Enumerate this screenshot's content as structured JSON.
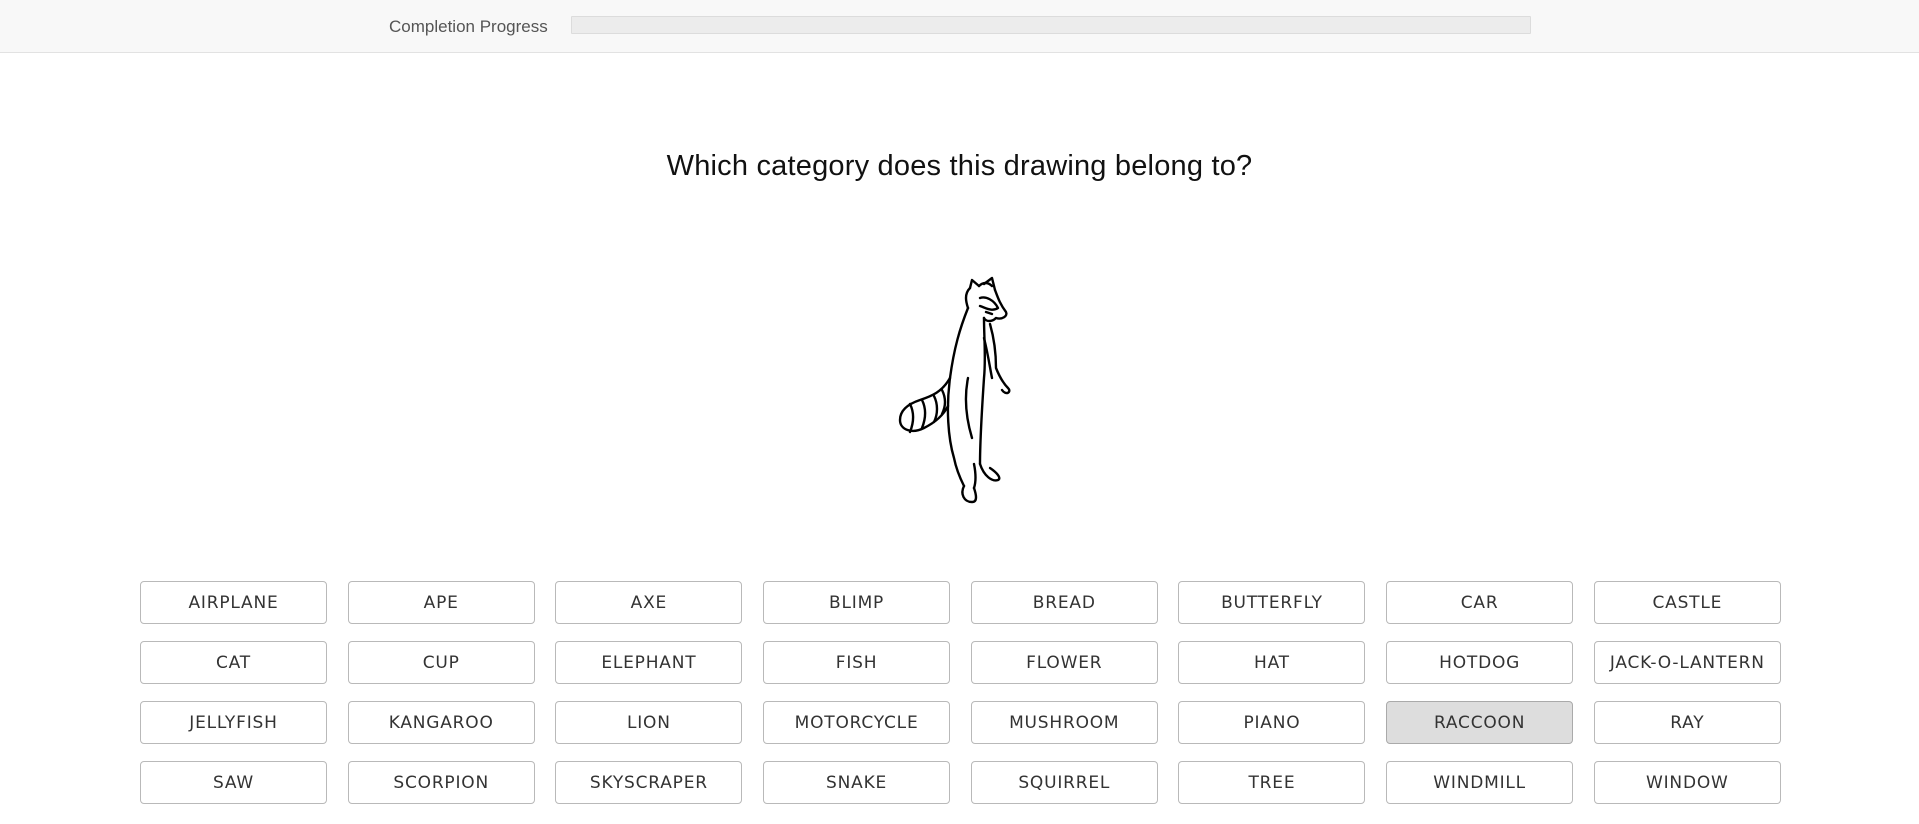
{
  "progress": {
    "label": "Completion Progress",
    "fraction": 0
  },
  "question": "Which category does this drawing belong to?",
  "drawing": {
    "depicts": "raccoon-sketch"
  },
  "categories": [
    {
      "label": "AIRPLANE",
      "selected": false
    },
    {
      "label": "APE",
      "selected": false
    },
    {
      "label": "AXE",
      "selected": false
    },
    {
      "label": "BLIMP",
      "selected": false
    },
    {
      "label": "BREAD",
      "selected": false
    },
    {
      "label": "BUTTERFLY",
      "selected": false
    },
    {
      "label": "CAR",
      "selected": false
    },
    {
      "label": "CASTLE",
      "selected": false
    },
    {
      "label": "CAT",
      "selected": false
    },
    {
      "label": "CUP",
      "selected": false
    },
    {
      "label": "ELEPHANT",
      "selected": false
    },
    {
      "label": "FISH",
      "selected": false
    },
    {
      "label": "FLOWER",
      "selected": false
    },
    {
      "label": "HAT",
      "selected": false
    },
    {
      "label": "HOTDOG",
      "selected": false
    },
    {
      "label": "JACK-O-LANTERN",
      "selected": false
    },
    {
      "label": "JELLYFISH",
      "selected": false
    },
    {
      "label": "KANGAROO",
      "selected": false
    },
    {
      "label": "LION",
      "selected": false
    },
    {
      "label": "MOTORCYCLE",
      "selected": false
    },
    {
      "label": "MUSHROOM",
      "selected": false
    },
    {
      "label": "PIANO",
      "selected": false
    },
    {
      "label": "RACCOON",
      "selected": true
    },
    {
      "label": "RAY",
      "selected": false
    },
    {
      "label": "SAW",
      "selected": false
    },
    {
      "label": "SCORPION",
      "selected": false
    },
    {
      "label": "SKYSCRAPER",
      "selected": false
    },
    {
      "label": "SNAKE",
      "selected": false
    },
    {
      "label": "SQUIRREL",
      "selected": false
    },
    {
      "label": "TREE",
      "selected": false
    },
    {
      "label": "WINDMILL",
      "selected": false
    },
    {
      "label": "WINDOW",
      "selected": false
    }
  ]
}
